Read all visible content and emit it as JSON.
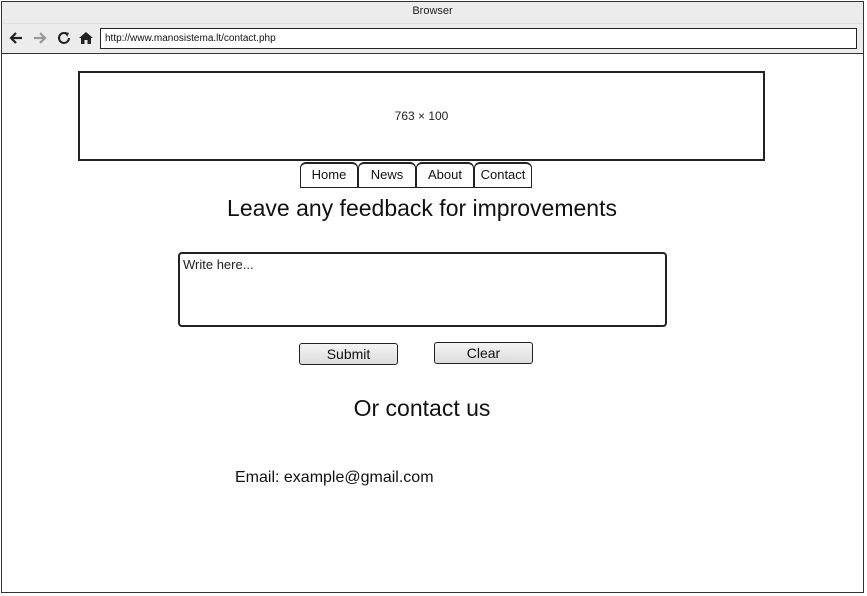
{
  "browser": {
    "title": "Browser",
    "url": "http://www.manosistema.lt/contact.php"
  },
  "toolbar": {
    "back_icon": "arrow-left-icon",
    "forward_icon": "arrow-right-icon",
    "reload_icon": "reload-icon",
    "home_icon": "home-icon"
  },
  "banner": {
    "label": "763 × 100"
  },
  "nav": {
    "tabs": [
      {
        "label": "Home"
      },
      {
        "label": "News"
      },
      {
        "label": "About"
      },
      {
        "label": "Contact"
      }
    ]
  },
  "feedback": {
    "heading": "Leave any feedback for improvements",
    "placeholder": "Write here...",
    "value": "",
    "submit_label": "Submit",
    "clear_label": "Clear"
  },
  "contact": {
    "heading": "Or contact us",
    "email_text": "Email: example@gmail.com"
  }
}
